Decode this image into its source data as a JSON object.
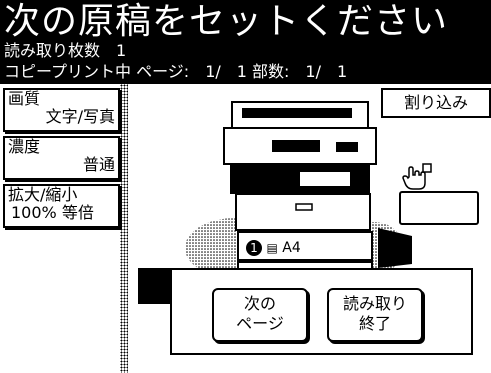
{
  "header": {
    "title": "次の原稿をセットください",
    "scan_count_line": "読み取り枚数　1",
    "status_line": "コピープリント中 ページ:　1/　1 部数:　1/　1"
  },
  "sidebar": {
    "quality": {
      "label": "画質",
      "value": "文字/写真"
    },
    "density": {
      "label": "濃度",
      "value": "普通"
    },
    "zoom": {
      "label": "拡大/縮小",
      "value": "100% 等倍"
    }
  },
  "interrupt": {
    "label": "割り込み"
  },
  "tray": {
    "number": "1",
    "paper": "A4"
  },
  "dialog": {
    "next_page": {
      "line1": "次の",
      "line2": "ページ"
    },
    "finish": {
      "line1": "読み取り",
      "line2": "終了"
    }
  }
}
